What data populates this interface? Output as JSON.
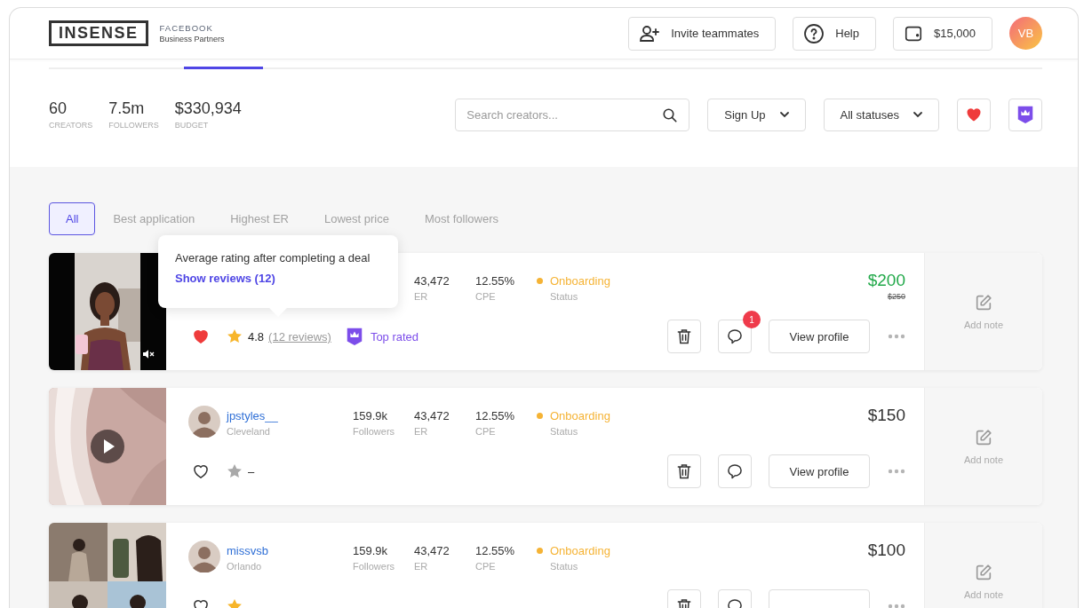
{
  "header": {
    "logo": "INSENSE",
    "partner_top": "FACEBOOK",
    "partner_bottom": "Business Partners",
    "buttons": [
      {
        "kind": "invite",
        "label": "Invite teammates"
      },
      {
        "kind": "help",
        "label": "Help"
      },
      {
        "kind": "wallet",
        "label": "$15,000"
      }
    ],
    "avatar": "VB"
  },
  "tab_strip": [
    {
      "selected": false
    },
    {
      "selected": true
    },
    {
      "selected": false
    }
  ],
  "stats": [
    {
      "value": "60",
      "label": "CREATORS"
    },
    {
      "value": "7.5m",
      "label": "FOLLOWERS"
    },
    {
      "value": "$330,934",
      "label": "BUDGET"
    }
  ],
  "search": {
    "placeholder": "Search creators..."
  },
  "dropdowns": [
    {
      "label": "Sign Up"
    },
    {
      "label": "All statuses"
    }
  ],
  "quick_filters": [
    {
      "kind": "favorites"
    },
    {
      "kind": "top_rated"
    }
  ],
  "filters": [
    {
      "label": "All",
      "selected": true
    },
    {
      "label": "Best application",
      "selected": false
    },
    {
      "label": "Highest ER",
      "selected": false
    },
    {
      "label": "Lowest price",
      "selected": false
    },
    {
      "label": "Most followers",
      "selected": false
    }
  ],
  "tooltip": {
    "text": "Average rating after completing a deal",
    "link": "Show reviews (12)"
  },
  "creators": [
    {
      "kind": "video_muted",
      "er": "43,472",
      "er_label": "ER",
      "cpe": "12.55%",
      "cpe_label": "CPE",
      "status": "Onboarding",
      "status_label": "Status",
      "color": "#f5b335",
      "price": "$200",
      "old_price": "$250",
      "liked": true,
      "rated": true,
      "rating": "4.8",
      "reviews": "(12 reviews)",
      "badge": "Top rated",
      "unread": "1",
      "actions": {
        "view": "View profile"
      },
      "note": "Add note"
    },
    {
      "kind": "video",
      "name": "jpstyles__",
      "location": "Cleveland",
      "followers": "159.9k",
      "followers_label": "Followers",
      "er": "43,472",
      "er_label": "ER",
      "cpe": "12.55%",
      "cpe_label": "CPE",
      "status": "Onboarding",
      "status_label": "Status",
      "color": "#f5b335",
      "price": "$150",
      "liked": false,
      "rated": false,
      "rating": "–",
      "actions": {
        "view": "View profile"
      },
      "note": "Add note"
    },
    {
      "kind": "collage",
      "name": "missvsb",
      "location": "Orlando",
      "followers": "159.9k",
      "followers_label": "Followers",
      "er": "43,472",
      "er_label": "ER",
      "cpe": "12.55%",
      "cpe_label": "CPE",
      "status": "Onboarding",
      "status_label": "Status",
      "color": "#f5b335",
      "price": "$100",
      "liked": false,
      "rated": true,
      "note": "Add note"
    }
  ]
}
